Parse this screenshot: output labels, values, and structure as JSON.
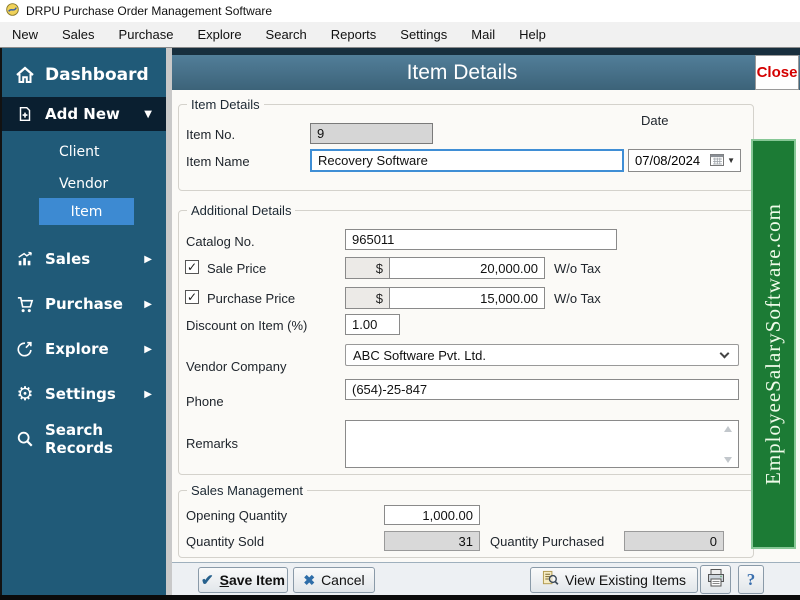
{
  "window": {
    "title": "DRPU Purchase Order Management Software"
  },
  "menubar": {
    "items": [
      "New",
      "Sales",
      "Purchase",
      "Explore",
      "Search",
      "Reports",
      "Settings",
      "Mail",
      "Help"
    ]
  },
  "sidebar": {
    "dashboard": "Dashboard",
    "add_new": "Add New",
    "client": "Client",
    "vendor": "Vendor",
    "item": "Item",
    "sales": "Sales",
    "purchase": "Purchase",
    "explore": "Explore",
    "settings": "Settings",
    "search_records": "Search Records"
  },
  "header": {
    "title": "Item Details",
    "close": "Close"
  },
  "item_details": {
    "legend": "Item Details",
    "item_no": {
      "label": "Item No.",
      "value": "9"
    },
    "item_name": {
      "label": "Item Name",
      "value": "Recovery Software"
    },
    "date": {
      "label": "Date",
      "value": "07/08/2024"
    }
  },
  "additional_details": {
    "legend": "Additional Details",
    "catalog_no": {
      "label": "Catalog No.",
      "value": "965011"
    },
    "sale_price": {
      "label": "Sale Price",
      "checked": true,
      "currency": "$",
      "value": "20,000.00",
      "suffix": "W/o Tax"
    },
    "purchase_price": {
      "label": "Purchase Price",
      "checked": true,
      "currency": "$",
      "value": "15,000.00",
      "suffix": "W/o Tax"
    },
    "discount": {
      "label": "Discount on Item (%)",
      "value": "1.00"
    },
    "vendor_company": {
      "label": "Vendor Company",
      "value": "ABC Software Pvt. Ltd."
    },
    "phone": {
      "label": "Phone",
      "value": "(654)-25-847"
    },
    "remarks": {
      "label": "Remarks",
      "value": ""
    }
  },
  "sales_management": {
    "legend": "Sales Management",
    "opening_quantity": {
      "label": "Opening Quantity",
      "value": "1,000.00"
    },
    "quantity_sold": {
      "label": "Quantity Sold",
      "value": "31"
    },
    "quantity_purchased": {
      "label": "Quantity Purchased",
      "value": "0"
    }
  },
  "actions": {
    "save": "Save Item",
    "cancel": "Cancel",
    "view_existing": "View Existing Items"
  },
  "banner": {
    "text": "EmployeeSalarySoftware.com"
  },
  "icons": {
    "gear_glyph": "⚙",
    "caret_down_glyph": "▼",
    "caret_right_glyph": "▶",
    "save_check_glyph": "✔",
    "cancel_x_glyph": "✖",
    "help_glyph": "?",
    "checkbox_check_glyph": "✓"
  },
  "colors": {
    "sidebar_bg": "#205a78",
    "sidebar_active": "#3d8ad2",
    "add_new_bg": "#0a1f30",
    "header_top": "#527e99",
    "header_bottom": "#3c6379",
    "close_red": "#d40000",
    "banner_green": "#1c7b35",
    "banner_border": "#86c796",
    "focus_blue": "#3f8ed5"
  }
}
